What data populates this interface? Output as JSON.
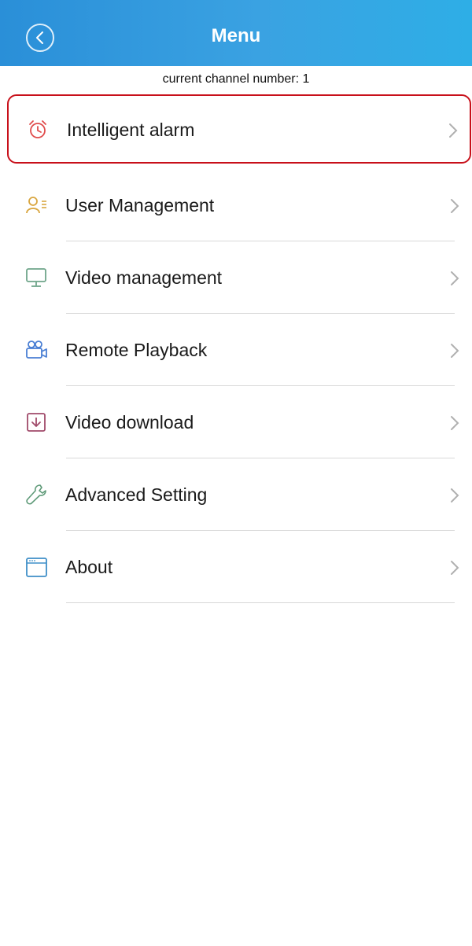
{
  "header": {
    "title": "Menu",
    "back_icon": "chevron-left-circle-icon",
    "color": "#3aa2e2"
  },
  "channel_text": "current channel number: 1",
  "menu": {
    "items": [
      {
        "label": "Intelligent alarm",
        "icon": "alarm-clock-icon",
        "selected": true
      },
      {
        "label": "User Management",
        "icon": "user-list-icon"
      },
      {
        "label": "Video management",
        "icon": "monitor-icon"
      },
      {
        "label": "Remote Playback",
        "icon": "video-camera-icon"
      },
      {
        "label": "Video download",
        "icon": "download-icon"
      },
      {
        "label": "Advanced Setting",
        "icon": "wrench-icon"
      },
      {
        "label": "About",
        "icon": "window-icon"
      }
    ],
    "selection_color": "#c8101a"
  }
}
